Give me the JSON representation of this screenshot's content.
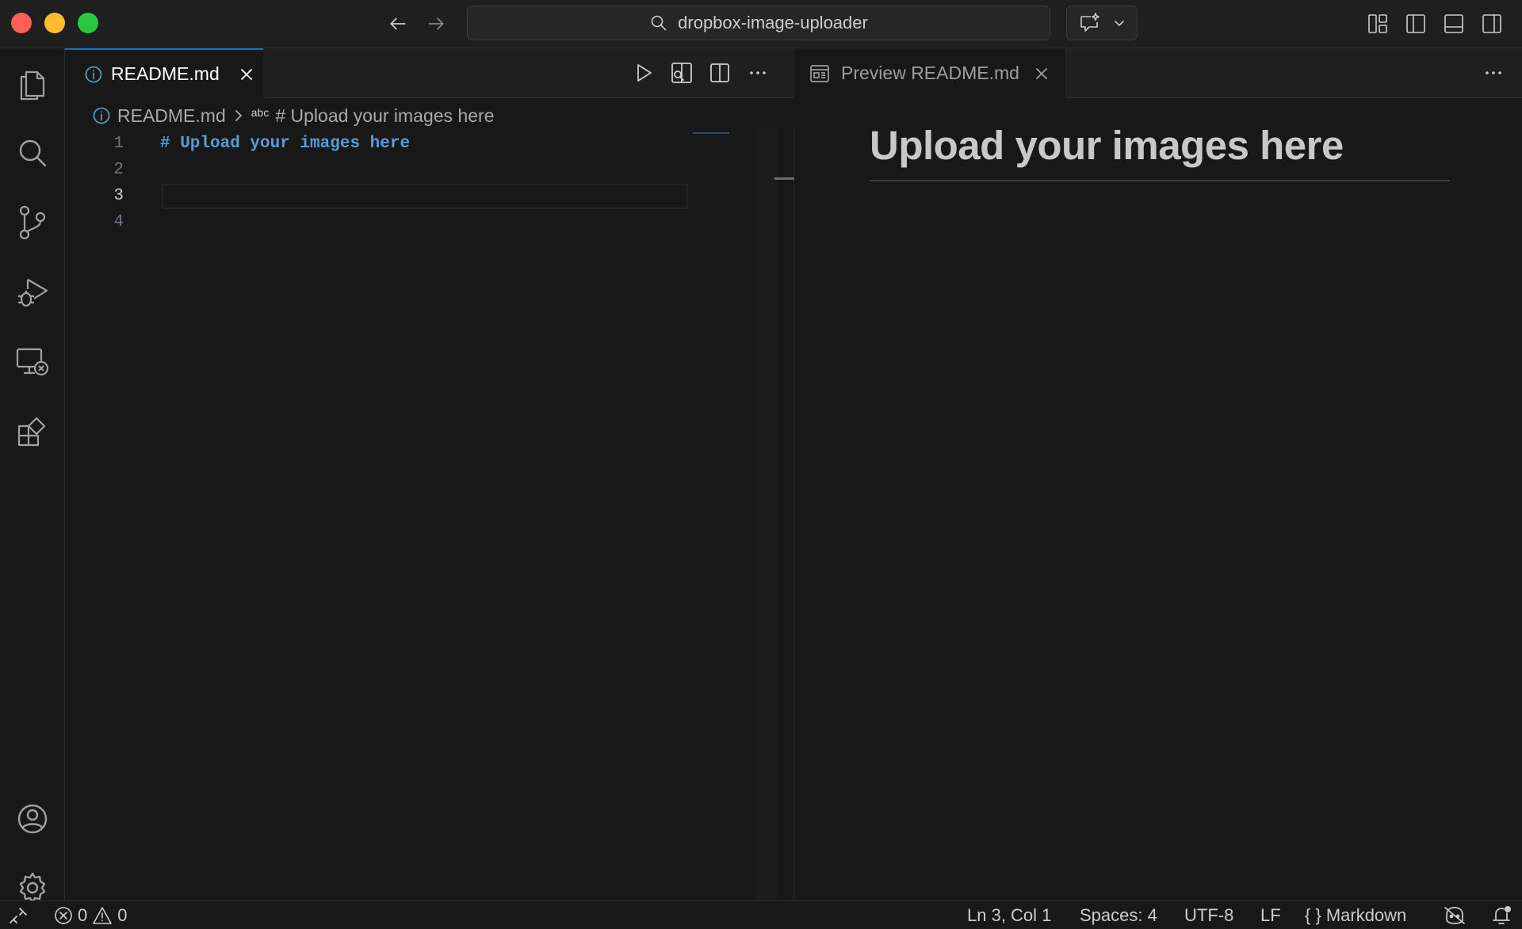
{
  "titlebar": {
    "search_text": "dropbox-image-uploader"
  },
  "editor_left": {
    "tab_label": "README.md",
    "breadcrumb": {
      "file": "README.md",
      "symbol_badge": "abc",
      "symbol": "# Upload your images here"
    },
    "line_numbers": [
      "1",
      "2",
      "3",
      "4"
    ],
    "current_line": 3,
    "lines": [
      "# Upload your images here",
      "",
      "",
      ""
    ]
  },
  "editor_right": {
    "tab_label": "Preview README.md",
    "preview_heading": "Upload your images here"
  },
  "statusbar": {
    "errors": "0",
    "warnings": "0",
    "cursor": "Ln 3, Col 1",
    "indent": "Spaces: 4",
    "encoding": "UTF-8",
    "eol": "LF",
    "language": "Markdown",
    "language_icon": "{ }"
  },
  "colors": {
    "accent": "#0078d4",
    "heading_code": "#569cd6",
    "background": "#181818"
  },
  "icons": {
    "activity": [
      "explorer-icon",
      "search-icon",
      "source-control-icon",
      "run-debug-icon",
      "remote-explorer-icon",
      "extensions-icon",
      "account-icon",
      "settings-gear-icon"
    ]
  }
}
